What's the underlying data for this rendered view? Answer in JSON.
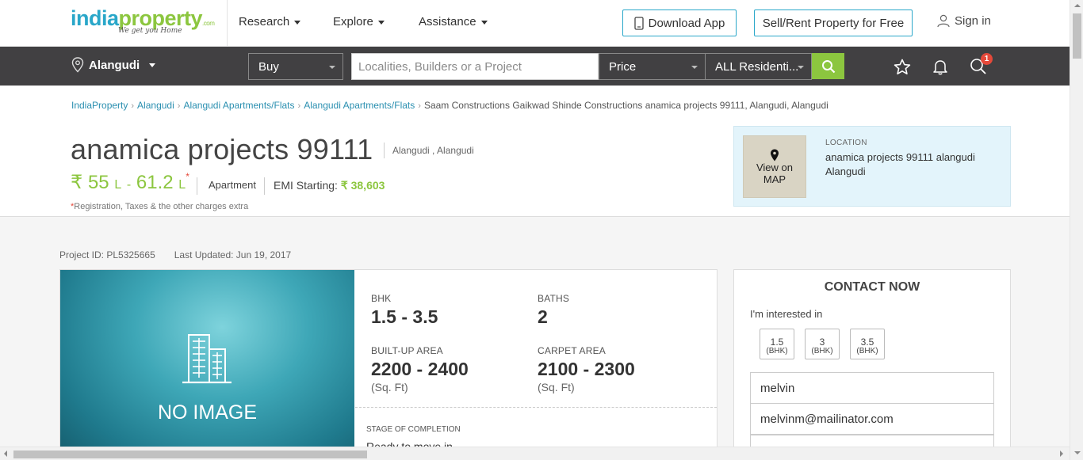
{
  "brand": {
    "part1": "india",
    "part2": "property",
    "domain": ".com",
    "tagline": "We get you Home"
  },
  "nav": {
    "research": "Research",
    "explore": "Explore",
    "assistance": "Assistance"
  },
  "header": {
    "download_app": "Download App",
    "sell_rent": "Sell/Rent Property for Free",
    "sign_in": "Sign in"
  },
  "search": {
    "city": "Alangudi",
    "mode": "Buy",
    "placeholder": "Localities, Builders or a Project",
    "price": "Price",
    "type": "ALL Residenti...",
    "notification_count": "1"
  },
  "breadcrumbs": [
    "IndiaProperty",
    "Alangudi",
    "Alangudi Apartments/Flats",
    "Alangudi Apartments/Flats",
    "Saam Constructions Gaikwad Shinde Constructions anamica projects 99111, Alangudi, Alangudi"
  ],
  "project": {
    "title": "anamica projects 99111",
    "locality": "Alangudi , Alangudi",
    "price_symbol": "₹",
    "price_low": "55",
    "price_low_unit": "L",
    "price_dash": "-",
    "price_high": "61.2",
    "price_high_unit": "L",
    "price_star": "*",
    "type": "Apartment",
    "emi_label": "EMI Starting:",
    "emi_value": "₹ 38,603",
    "note_star": "*",
    "note": "Registration, Taxes & the other charges extra"
  },
  "location_box": {
    "map_label_1": "View on",
    "map_label_2": "MAP",
    "heading": "LOCATION",
    "line1": "anamica projects 99111 alangudi",
    "line2": "Alangudi"
  },
  "meta": {
    "project_id": "Project ID: PL5325665",
    "last_updated": "Last Updated: Jun 19, 2017"
  },
  "specs": {
    "no_image": "NO IMAGE",
    "bhk_label": "BHK",
    "bhk_value": "1.5 - 3.5",
    "baths_label": "BATHS",
    "baths_value": "2",
    "builtup_label": "BUILT-UP AREA",
    "builtup_value": "2200 - 2400",
    "builtup_unit": "(Sq. Ft)",
    "carpet_label": "CARPET AREA",
    "carpet_value": "2100 - 2300",
    "carpet_unit": "(Sq. Ft)",
    "stage_label": "STAGE OF COMPLETION",
    "stage_value": "Ready to move in"
  },
  "contact": {
    "heading": "CONTACT NOW",
    "interested": "I'm interested in",
    "chips": [
      {
        "value": "1.5",
        "unit": "(BHK)"
      },
      {
        "value": "3",
        "unit": "(BHK)"
      },
      {
        "value": "3.5",
        "unit": "(BHK)"
      }
    ],
    "name_value": "melvin",
    "email_value": "melvinm@mailinator.com"
  },
  "colors": {
    "accent_green": "#8cc63f",
    "accent_blue": "#2aa7c9",
    "bar_dark": "#414042",
    "badge_red": "#e5493a"
  }
}
